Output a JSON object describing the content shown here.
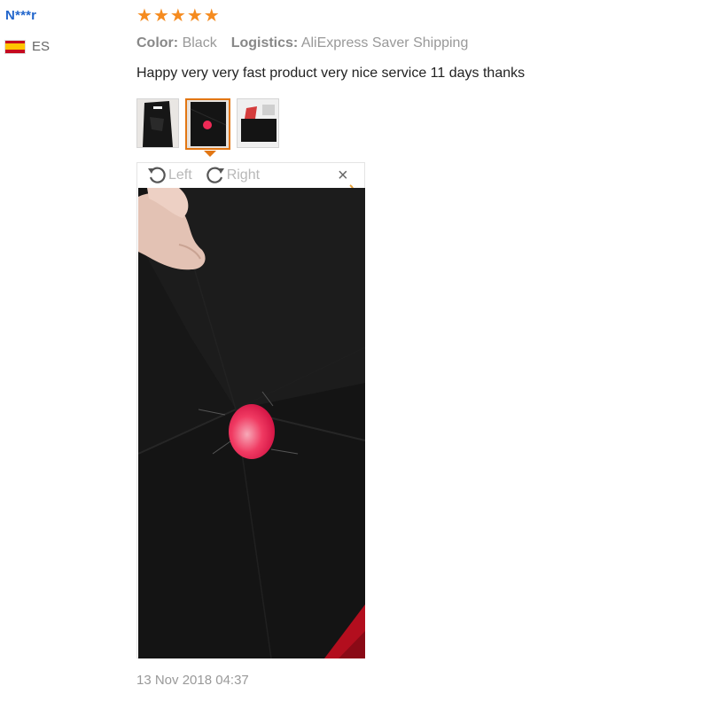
{
  "review": {
    "username": "N***r",
    "country_code": "ES",
    "rating": 5,
    "stars": [
      "★",
      "★",
      "★",
      "★",
      "★"
    ],
    "attributes": [
      {
        "name": "Color:",
        "value": "Black"
      },
      {
        "name": "Logistics:",
        "value": "AliExpress Saver Shipping"
      }
    ],
    "text": "Happy very very fast product very nice service 11 days thanks",
    "date": "13 Nov 2018 04:37",
    "selected_thumbnail": 2
  },
  "viewer": {
    "rotate_left_label": "Left",
    "rotate_right_label": "Right",
    "close_glyph": "×"
  },
  "colors": {
    "username": "#2266cc",
    "star": "#f58b1f",
    "accent_border": "#e27613",
    "flag_red": "#c60b1e",
    "flag_yellow": "#ffc400"
  },
  "icons": [
    "spain-flag-icon",
    "star-icon",
    "rotate-left-icon",
    "rotate-right-icon",
    "close-icon",
    "loading-icon"
  ]
}
